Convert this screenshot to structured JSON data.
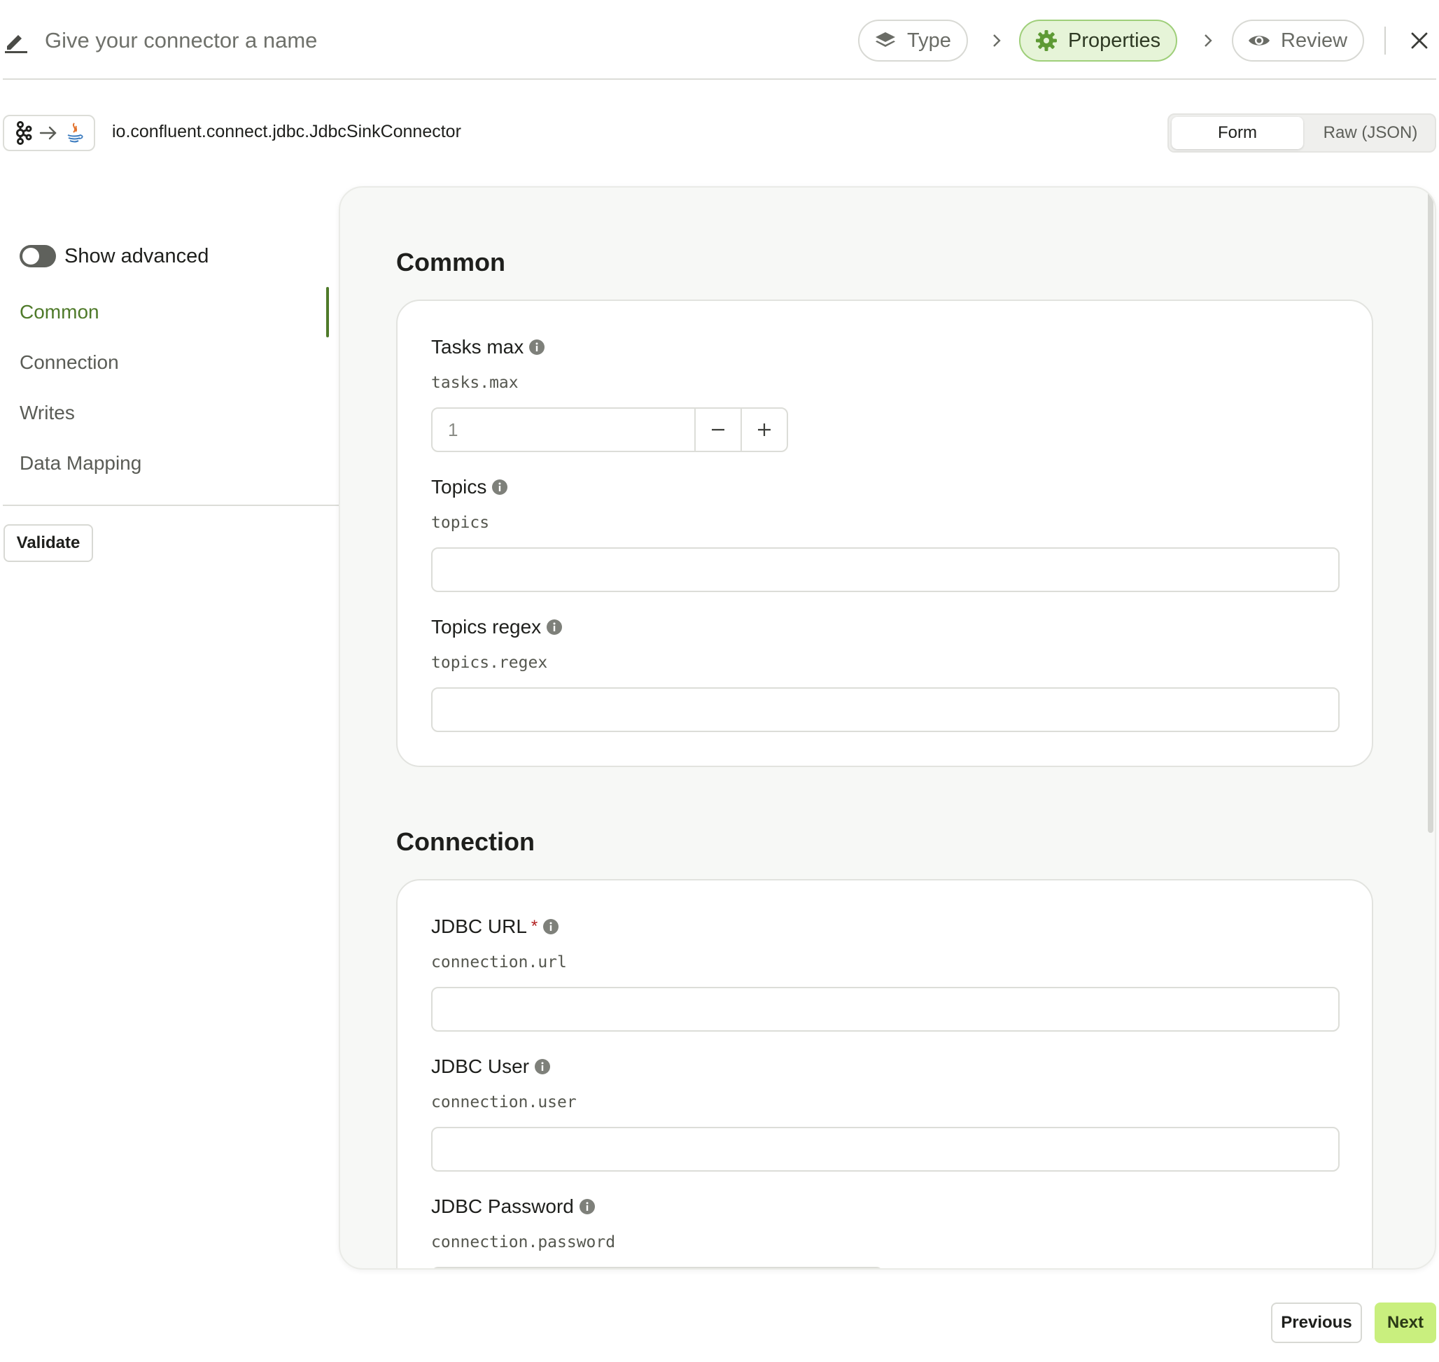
{
  "header": {
    "name_placeholder": "Give your connector a name",
    "steps": [
      {
        "label": "Type",
        "icon": "layers-icon",
        "state": "done"
      },
      {
        "label": "Properties",
        "icon": "gear-icon",
        "state": "active"
      },
      {
        "label": "Review",
        "icon": "eye-icon",
        "state": "pending"
      }
    ],
    "accent_color": "#4f7a2a"
  },
  "connector": {
    "class_name": "io.confluent.connect.jdbc.JdbcSinkConnector",
    "icons": [
      "kafka-icon",
      "arrow-right-icon",
      "java-icon"
    ]
  },
  "view_toggle": {
    "options": [
      "Form",
      "Raw (JSON)"
    ],
    "selected": "Form"
  },
  "sidebar": {
    "show_advanced_label": "Show advanced",
    "show_advanced": false,
    "items": [
      {
        "label": "Common",
        "active": true
      },
      {
        "label": "Connection",
        "active": false
      },
      {
        "label": "Writes",
        "active": false
      },
      {
        "label": "Data Mapping",
        "active": false
      }
    ],
    "validate_label": "Validate"
  },
  "sections": {
    "common": {
      "title": "Common",
      "fields": [
        {
          "label": "Tasks max",
          "key": "tasks.max",
          "value": "1",
          "type": "number"
        },
        {
          "label": "Topics",
          "key": "topics",
          "value": "",
          "type": "text"
        },
        {
          "label": "Topics regex",
          "key": "topics.regex",
          "value": "",
          "type": "text"
        }
      ]
    },
    "connection": {
      "title": "Connection",
      "fields": [
        {
          "label": "JDBC URL",
          "required_mark": "*",
          "key": "connection.url",
          "value": "",
          "type": "text"
        },
        {
          "label": "JDBC User",
          "key": "connection.user",
          "value": "",
          "type": "text"
        },
        {
          "label": "JDBC Password",
          "key": "connection.password",
          "value": "",
          "type": "password"
        }
      ]
    }
  },
  "footer": {
    "previous_label": "Previous",
    "next_label": "Next",
    "next_color": "#c9ef7e"
  }
}
